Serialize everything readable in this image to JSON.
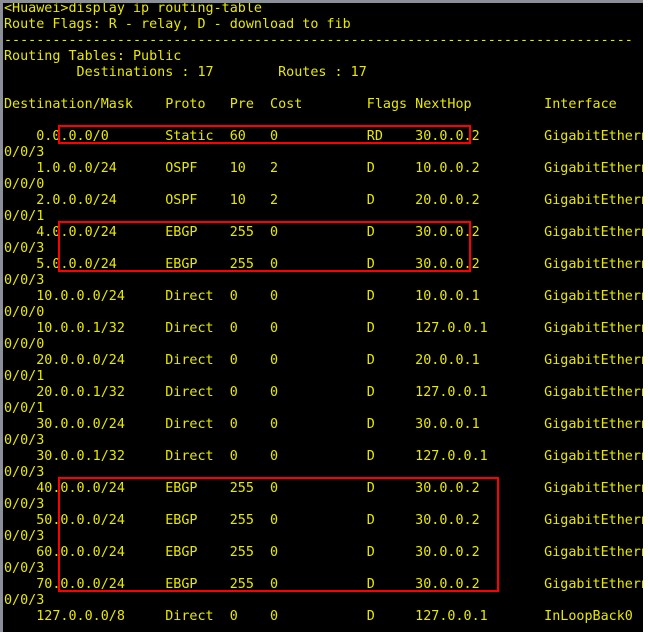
{
  "terminal": {
    "prompt_line": "<Huawei>display ip routing-table",
    "route_flags_line": "Route Flags: R - relay, D - download to fib",
    "separator_line": "------------------------------------------------------------------------------",
    "routing_tables_line": "Routing Tables: Public",
    "counts_line": "         Destinations : 17        Routes : 17",
    "header_line": "Destination/Mask    Proto   Pre  Cost        Flags NextHop         Interface",
    "colors": {
      "text": "#e8e800",
      "background": "#000000",
      "highlight_box": "#ff0000",
      "window_chrome": "#8a8f98"
    },
    "summary": {
      "table_name": "Public",
      "destinations": "17",
      "routes": "17"
    },
    "columns": [
      "Destination/Mask",
      "Proto",
      "Pre",
      "Cost",
      "Flags",
      "NextHop",
      "Interface"
    ],
    "routes": [
      {
        "dest": "0.0.0.0/0",
        "proto": "Static",
        "pre": "60",
        "cost": "0",
        "flags": "RD",
        "nexthop": "30.0.0.2",
        "interface": "GigabitEthernet",
        "interface_cont": "0/0/3",
        "highlighted": true
      },
      {
        "dest": "1.0.0.0/24",
        "proto": "OSPF",
        "pre": "10",
        "cost": "2",
        "flags": "D",
        "nexthop": "10.0.0.2",
        "interface": "GigabitEthernet",
        "interface_cont": "0/0/0",
        "highlighted": false
      },
      {
        "dest": "2.0.0.0/24",
        "proto": "OSPF",
        "pre": "10",
        "cost": "2",
        "flags": "D",
        "nexthop": "20.0.0.2",
        "interface": "GigabitEthernet",
        "interface_cont": "0/0/1",
        "highlighted": false
      },
      {
        "dest": "4.0.0.0/24",
        "proto": "EBGP",
        "pre": "255",
        "cost": "0",
        "flags": "D",
        "nexthop": "30.0.0.2",
        "interface": "GigabitEthernet",
        "interface_cont": "0/0/3",
        "highlighted": true
      },
      {
        "dest": "5.0.0.0/24",
        "proto": "EBGP",
        "pre": "255",
        "cost": "0",
        "flags": "D",
        "nexthop": "30.0.0.2",
        "interface": "GigabitEthernet",
        "interface_cont": "0/0/3",
        "highlighted": true
      },
      {
        "dest": "10.0.0.0/24",
        "proto": "Direct",
        "pre": "0",
        "cost": "0",
        "flags": "D",
        "nexthop": "10.0.0.1",
        "interface": "GigabitEthernet",
        "interface_cont": "0/0/0",
        "highlighted": false
      },
      {
        "dest": "10.0.0.1/32",
        "proto": "Direct",
        "pre": "0",
        "cost": "0",
        "flags": "D",
        "nexthop": "127.0.0.1",
        "interface": "GigabitEthernet",
        "interface_cont": "0/0/0",
        "highlighted": false
      },
      {
        "dest": "20.0.0.0/24",
        "proto": "Direct",
        "pre": "0",
        "cost": "0",
        "flags": "D",
        "nexthop": "20.0.0.1",
        "interface": "GigabitEthernet",
        "interface_cont": "0/0/1",
        "highlighted": false
      },
      {
        "dest": "20.0.0.1/32",
        "proto": "Direct",
        "pre": "0",
        "cost": "0",
        "flags": "D",
        "nexthop": "127.0.0.1",
        "interface": "GigabitEthernet",
        "interface_cont": "0/0/1",
        "highlighted": false
      },
      {
        "dest": "30.0.0.0/24",
        "proto": "Direct",
        "pre": "0",
        "cost": "0",
        "flags": "D",
        "nexthop": "30.0.0.1",
        "interface": "GigabitEthernet",
        "interface_cont": "0/0/3",
        "highlighted": false
      },
      {
        "dest": "30.0.0.1/32",
        "proto": "Direct",
        "pre": "0",
        "cost": "0",
        "flags": "D",
        "nexthop": "127.0.0.1",
        "interface": "GigabitEthernet",
        "interface_cont": "0/0/3",
        "highlighted": false
      },
      {
        "dest": "40.0.0.0/24",
        "proto": "EBGP",
        "pre": "255",
        "cost": "0",
        "flags": "D",
        "nexthop": "30.0.0.2",
        "interface": "GigabitEthernet",
        "interface_cont": "0/0/3",
        "highlighted": true
      },
      {
        "dest": "50.0.0.0/24",
        "proto": "EBGP",
        "pre": "255",
        "cost": "0",
        "flags": "D",
        "nexthop": "30.0.0.2",
        "interface": "GigabitEthernet",
        "interface_cont": "0/0/3",
        "highlighted": true
      },
      {
        "dest": "60.0.0.0/24",
        "proto": "EBGP",
        "pre": "255",
        "cost": "0",
        "flags": "D",
        "nexthop": "30.0.0.2",
        "interface": "GigabitEthernet",
        "interface_cont": "0/0/3",
        "highlighted": true
      },
      {
        "dest": "70.0.0.0/24",
        "proto": "EBGP",
        "pre": "255",
        "cost": "0",
        "flags": "D",
        "nexthop": "30.0.0.2",
        "interface": "GigabitEthernet",
        "interface_cont": "0/0/3",
        "highlighted": true
      },
      {
        "dest": "127.0.0.0/8",
        "proto": "Direct",
        "pre": "0",
        "cost": "0",
        "flags": "D",
        "nexthop": "127.0.0.1",
        "interface": "InLoopBack0",
        "interface_cont": "",
        "highlighted": false
      }
    ]
  }
}
